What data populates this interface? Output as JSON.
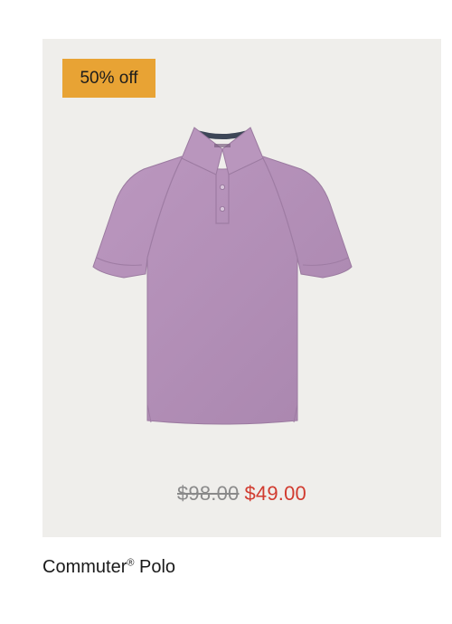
{
  "product": {
    "badge": "50% off",
    "name_main": "Commuter",
    "name_mark": "®",
    "name_suffix": " Polo",
    "price_original": "$98.00",
    "price_sale": "$49.00",
    "image_icon": "polo-shirt-image",
    "colors": {
      "panel_bg": "#efeeeb",
      "badge_bg": "#e8a334",
      "sale_price": "#d13b2f",
      "original_price": "#8a8a8a",
      "shirt": "#b592b8"
    }
  }
}
